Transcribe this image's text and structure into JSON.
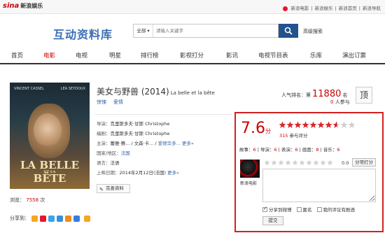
{
  "topbar": {
    "logo_text": "sina",
    "logo_suffix": "新浪娱乐",
    "links": [
      "新浪电影",
      "新浪娱乐",
      "新浪首页",
      "新浪导航"
    ]
  },
  "brand": "互动资料库",
  "search": {
    "scope": "全部",
    "placeholder": "请输入关键字",
    "advanced": "高级搜索"
  },
  "nav": [
    "首页",
    "电影",
    "电视",
    "明星",
    "排行榜",
    "影视打分",
    "影讯",
    "电视节目表",
    "乐库",
    "演出订票"
  ],
  "nav_active": "电影",
  "poster": {
    "actor1": "VINCENT CASSEL",
    "actor2": "LÉA SEYDOUX",
    "title_line1": "LA",
    "title_line2": "BELLE",
    "title_small": "ET LA",
    "title_line3": "BÊTE"
  },
  "movie": {
    "title": "美女与野兽 (2014)",
    "title_en": "La belle et la bête",
    "genres": [
      "惊悚",
      "爱情"
    ],
    "rank_label": "人气排名：第",
    "rank": "11880",
    "rank_suffix": "名",
    "people_count": "0",
    "people_label": "人参与",
    "ding": "顶",
    "director_k": "导演：",
    "director_v": "克里斯多夫·甘斯 Christophe",
    "writer_k": "编剧：",
    "writer_v": "克里斯多夫·甘斯 Christophe",
    "cast_k": "主演：",
    "cast_v": "蕾雅·赛... / 文森·卡... / ",
    "cast_more_actor": "爱德华多...",
    "cast_more": "更多»",
    "country_k": "国家/地区：",
    "country_v": "法国",
    "lang_k": "语言：",
    "lang_v": "法语",
    "date_k": "上映日期：",
    "date_v": "2014年2月12日(法国)",
    "date_more": "更多»",
    "edit": "完善资料",
    "view_label": "浏览：",
    "view_count": "7558",
    "view_unit": "次",
    "share_label": "分享到："
  },
  "rating": {
    "score": "7.6",
    "score_unit": "分",
    "stars": 7.6,
    "count": "315",
    "count_label": "参与评分",
    "subs": [
      {
        "k": "故事：",
        "v": "6"
      },
      {
        "k": "导演：",
        "v": "6"
      },
      {
        "k": "表演：",
        "v": "6"
      },
      {
        "k": "画面：",
        "v": "8"
      },
      {
        "k": "音乐：",
        "v": "6"
      }
    ],
    "user": "新浪电影",
    "input_score": "0.0",
    "rate_btn": "分项打分",
    "opt_weibo": "分享到微博",
    "opt_anon": "匿名",
    "opt_top": "我的评论有剧透",
    "submit": "提交"
  },
  "colors": {
    "accent": "#cc0000",
    "link": "#3566a8",
    "search_btn": "#23528d"
  }
}
